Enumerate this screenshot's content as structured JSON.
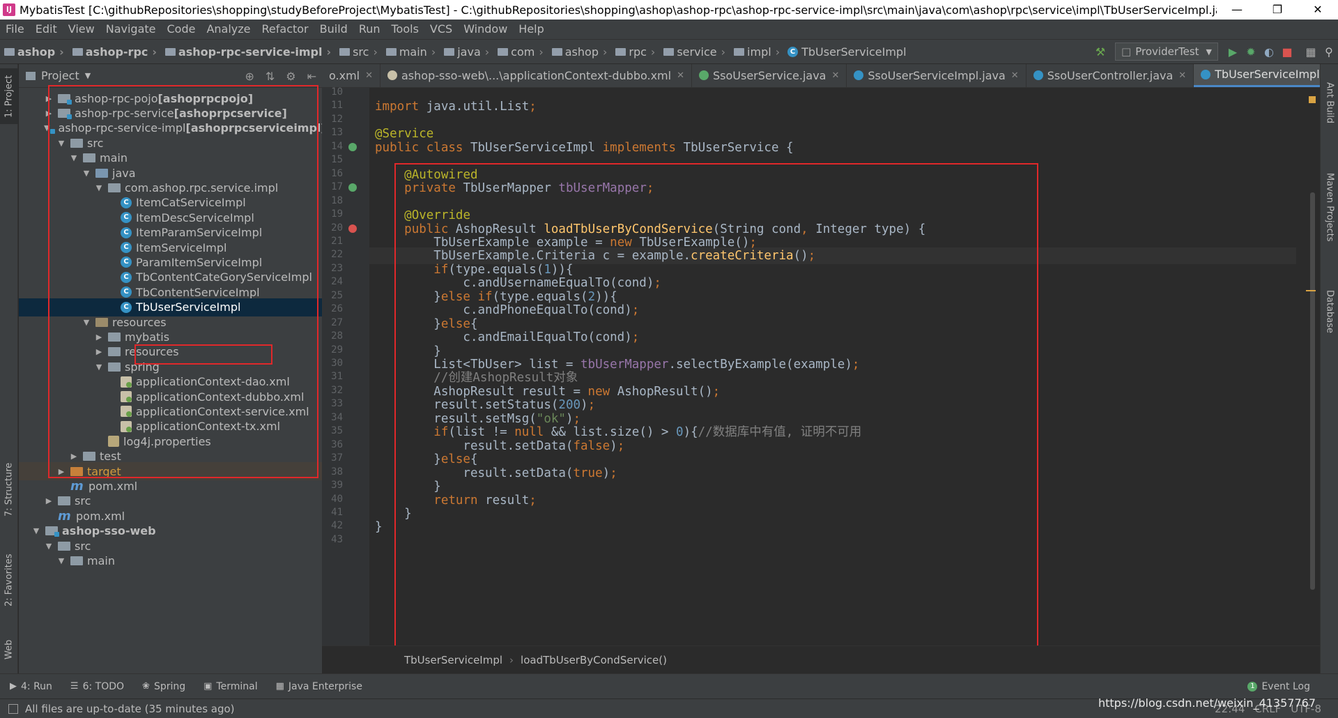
{
  "window": {
    "title": "MybatisTest [C:\\githubRepositories\\shopping\\studyBeforeProject\\MybatisTest] - C:\\githubRepositories\\shopping\\ashop\\ashop-rpc\\ashop-rpc-service-impl\\src\\main\\java\\com\\ashop\\rpc\\service\\impl\\TbUserServiceImpl.java [ashoprpc..."
  },
  "menu": [
    "File",
    "Edit",
    "View",
    "Navigate",
    "Code",
    "Analyze",
    "Refactor",
    "Build",
    "Run",
    "Tools",
    "VCS",
    "Window",
    "Help"
  ],
  "nav": {
    "crumbs": [
      "ashop",
      "ashop-rpc",
      "ashop-rpc-service-impl",
      "src",
      "main",
      "java",
      "com",
      "ashop",
      "rpc",
      "service",
      "impl"
    ],
    "file": "TbUserServiceImpl",
    "run_config": "ProviderTest"
  },
  "left_tabs": {
    "project": "1: Project",
    "structure": "7: Structure",
    "favorites": "2: Favorites",
    "web": "Web"
  },
  "right_tabs": {
    "ant": "Ant Build",
    "maven": "Maven Projects",
    "database": "Database"
  },
  "project": {
    "header": "Project",
    "tree": [
      {
        "indent": 1,
        "arrow": "right",
        "icon": "mod",
        "label": "ashop-rpc-pojo",
        "suffix": " [ashoprpcpojo]"
      },
      {
        "indent": 1,
        "arrow": "right",
        "icon": "mod",
        "label": "ashop-rpc-service",
        "suffix": " [ashoprpcservice]"
      },
      {
        "indent": 1,
        "arrow": "down",
        "icon": "mod",
        "label": "ashop-rpc-service-impl",
        "suffix": " [ashoprpcserviceimpl]"
      },
      {
        "indent": 2,
        "arrow": "down",
        "icon": "folder",
        "label": "src",
        "suffix": ""
      },
      {
        "indent": 3,
        "arrow": "down",
        "icon": "folder",
        "label": "main",
        "suffix": ""
      },
      {
        "indent": 4,
        "arrow": "down",
        "icon": "src",
        "label": "java",
        "suffix": ""
      },
      {
        "indent": 5,
        "arrow": "down",
        "icon": "pkg",
        "label": "com.ashop.rpc.service.impl",
        "suffix": ""
      },
      {
        "indent": 6,
        "arrow": "",
        "icon": "class",
        "label": "ItemCatServiceImpl",
        "suffix": ""
      },
      {
        "indent": 6,
        "arrow": "",
        "icon": "class",
        "label": "ItemDescServiceImpl",
        "suffix": ""
      },
      {
        "indent": 6,
        "arrow": "",
        "icon": "class",
        "label": "ItemParamServiceImpl",
        "suffix": ""
      },
      {
        "indent": 6,
        "arrow": "",
        "icon": "class",
        "label": "ItemServiceImpl",
        "suffix": ""
      },
      {
        "indent": 6,
        "arrow": "",
        "icon": "class",
        "label": "ParamItemServiceImpl",
        "suffix": ""
      },
      {
        "indent": 6,
        "arrow": "",
        "icon": "class",
        "label": "TbContentCateGoryServiceImpl",
        "suffix": ""
      },
      {
        "indent": 6,
        "arrow": "",
        "icon": "class",
        "label": "TbContentServiceImpl",
        "suffix": ""
      },
      {
        "indent": 6,
        "arrow": "",
        "icon": "class",
        "label": "TbUserServiceImpl",
        "suffix": "",
        "selected": true
      },
      {
        "indent": 4,
        "arrow": "down",
        "icon": "res",
        "label": "resources",
        "suffix": ""
      },
      {
        "indent": 5,
        "arrow": "right",
        "icon": "folder",
        "label": "mybatis",
        "suffix": ""
      },
      {
        "indent": 5,
        "arrow": "right",
        "icon": "folder",
        "label": "resources",
        "suffix": ""
      },
      {
        "indent": 5,
        "arrow": "down",
        "icon": "folder",
        "label": "spring",
        "suffix": ""
      },
      {
        "indent": 6,
        "arrow": "",
        "icon": "xml",
        "label": "applicationContext-dao.xml",
        "suffix": ""
      },
      {
        "indent": 6,
        "arrow": "",
        "icon": "xml",
        "label": "applicationContext-dubbo.xml",
        "suffix": ""
      },
      {
        "indent": 6,
        "arrow": "",
        "icon": "xml",
        "label": "applicationContext-service.xml",
        "suffix": ""
      },
      {
        "indent": 6,
        "arrow": "",
        "icon": "xml",
        "label": "applicationContext-tx.xml",
        "suffix": ""
      },
      {
        "indent": 5,
        "arrow": "",
        "icon": "prop",
        "label": "log4j.properties",
        "suffix": ""
      },
      {
        "indent": 3,
        "arrow": "right",
        "icon": "folder",
        "label": "test",
        "suffix": ""
      },
      {
        "indent": 2,
        "arrow": "right",
        "icon": "orange",
        "label": "target",
        "suffix": "",
        "excluded": true
      },
      {
        "indent": 2,
        "arrow": "",
        "icon": "maven",
        "label": "pom.xml",
        "suffix": ""
      },
      {
        "indent": 1,
        "arrow": "right",
        "icon": "folder",
        "label": "src",
        "suffix": ""
      },
      {
        "indent": 1,
        "arrow": "",
        "icon": "maven",
        "label": "pom.xml",
        "suffix": ""
      },
      {
        "indent": 0,
        "arrow": "down",
        "icon": "mod",
        "label": "ashop-sso-web",
        "suffix": "",
        "bold": true
      },
      {
        "indent": 1,
        "arrow": "down",
        "icon": "folder",
        "label": "src",
        "suffix": ""
      },
      {
        "indent": 2,
        "arrow": "down",
        "icon": "folder",
        "label": "main",
        "suffix": ""
      }
    ]
  },
  "tabs": [
    {
      "label": "o.xml",
      "icon": "",
      "active": false
    },
    {
      "label": "ashop-sso-web\\...\\applicationContext-dubbo.xml",
      "icon": "xml",
      "active": false
    },
    {
      "label": "SsoUserService.java",
      "icon": "iface",
      "active": false
    },
    {
      "label": "SsoUserServiceImpl.java",
      "icon": "class",
      "active": false
    },
    {
      "label": "SsoUserController.java",
      "icon": "class",
      "active": false
    },
    {
      "label": "TbUserServiceImpl.java",
      "icon": "class",
      "active": true
    }
  ],
  "code": {
    "first_line": 10,
    "lines": [
      [],
      [
        [
          "kw",
          "import "
        ],
        [
          "",
          "java.util.List"
        ],
        [
          "kw",
          ";"
        ]
      ],
      [],
      [
        [
          "an",
          "@Service"
        ]
      ],
      [
        [
          "kw",
          "public class "
        ],
        [
          "",
          "TbUserServiceImpl "
        ],
        [
          "kw",
          "implements "
        ],
        [
          "",
          "TbUserService {"
        ]
      ],
      [],
      [
        [
          "",
          "    "
        ],
        [
          "an",
          "@Autowired"
        ]
      ],
      [
        [
          "",
          "    "
        ],
        [
          "kw",
          "private "
        ],
        [
          "",
          "TbUserMapper "
        ],
        [
          "fld",
          "tbUserMapper"
        ],
        [
          "kw",
          ";"
        ]
      ],
      [],
      [
        [
          "",
          "    "
        ],
        [
          "an",
          "@Override"
        ]
      ],
      [
        [
          "",
          "    "
        ],
        [
          "kw",
          "public "
        ],
        [
          "",
          "AshopResult "
        ],
        [
          "mth",
          "loadTbUserByCondService"
        ],
        [
          "",
          "(String cond"
        ],
        [
          "kw",
          ", "
        ],
        [
          "",
          "Integer type) {"
        ]
      ],
      [
        [
          "",
          "        TbUserExample example = "
        ],
        [
          "kw",
          "new "
        ],
        [
          "",
          "TbUserExample()"
        ],
        [
          "kw",
          ";"
        ]
      ],
      [
        [
          "",
          "        TbUserExample.Criteria c = example."
        ],
        [
          "mth",
          "createCriteria"
        ],
        [
          "",
          "()"
        ],
        [
          "kw",
          ";"
        ]
      ],
      [
        [
          "",
          "        "
        ],
        [
          "kw",
          "if"
        ],
        [
          "",
          "(type.equals("
        ],
        [
          "num",
          "1"
        ],
        [
          "",
          "))"
        ],
        [
          "",
          "{"
        ]
      ],
      [
        [
          "",
          "            c.andUsernameEqualTo(cond)"
        ],
        [
          "kw",
          ";"
        ]
      ],
      [
        [
          "",
          "        }"
        ],
        [
          "kw",
          "else if"
        ],
        [
          "",
          "(type.equals("
        ],
        [
          "num",
          "2"
        ],
        [
          "",
          "))"
        ],
        [
          "",
          "{"
        ]
      ],
      [
        [
          "",
          "            c.andPhoneEqualTo(cond)"
        ],
        [
          "kw",
          ";"
        ]
      ],
      [
        [
          "",
          "        }"
        ],
        [
          "kw",
          "else"
        ],
        [
          "",
          "{"
        ]
      ],
      [
        [
          "",
          "            c.andEmailEqualTo(cond)"
        ],
        [
          "kw",
          ";"
        ]
      ],
      [
        [
          "",
          "        }"
        ]
      ],
      [
        [
          "",
          "        List<TbUser> list = "
        ],
        [
          "fld",
          "tbUserMapper"
        ],
        [
          "",
          ".selectByExample(example)"
        ],
        [
          "kw",
          ";"
        ]
      ],
      [
        [
          "",
          "        "
        ],
        [
          "cmt",
          "//创建AshopResult对象"
        ]
      ],
      [
        [
          "",
          "        AshopResult result = "
        ],
        [
          "kw",
          "new "
        ],
        [
          "",
          "AshopResult()"
        ],
        [
          "kw",
          ";"
        ]
      ],
      [
        [
          "",
          "        result.setStatus("
        ],
        [
          "num",
          "200"
        ],
        [
          "",
          ")"
        ],
        [
          "kw",
          ";"
        ]
      ],
      [
        [
          "",
          "        result.setMsg("
        ],
        [
          "str",
          "\"ok\""
        ],
        [
          "",
          ")"
        ],
        [
          "kw",
          ";"
        ]
      ],
      [
        [
          "",
          "        "
        ],
        [
          "kw",
          "if"
        ],
        [
          "",
          "(list != "
        ],
        [
          "kw",
          "null "
        ],
        [
          "",
          "&& list.size() > "
        ],
        [
          "num",
          "0"
        ],
        [
          "",
          ")"
        ],
        [
          "",
          "{"
        ],
        [
          "cmt",
          "//数据库中有值, 证明不可用"
        ]
      ],
      [
        [
          "",
          "            result.setData("
        ],
        [
          "kw",
          "false"
        ],
        [
          "",
          ")"
        ],
        [
          "kw",
          ";"
        ]
      ],
      [
        [
          "",
          "        }"
        ],
        [
          "kw",
          "else"
        ],
        [
          "",
          "{"
        ]
      ],
      [
        [
          "",
          "            result.setData("
        ],
        [
          "kw",
          "true"
        ],
        [
          "",
          ")"
        ],
        [
          "kw",
          ";"
        ]
      ],
      [
        [
          "",
          "        }"
        ]
      ],
      [
        [
          "",
          "        "
        ],
        [
          "kw",
          "return "
        ],
        [
          "",
          "result"
        ],
        [
          "kw",
          ";"
        ]
      ],
      [
        [
          "",
          "    }"
        ]
      ],
      [
        [
          "",
          "}"
        ]
      ],
      []
    ]
  },
  "editor_breadcrumb": [
    "TbUserServiceImpl",
    "loadTbUserByCondService()"
  ],
  "bottom_tabs": [
    {
      "icon": "▶",
      "label": "4: Run"
    },
    {
      "icon": "☰",
      "label": "6: TODO"
    },
    {
      "icon": "❀",
      "label": "Spring"
    },
    {
      "icon": "▣",
      "label": "Terminal"
    },
    {
      "icon": "▦",
      "label": "Java Enterprise"
    }
  ],
  "event_log": "Event Log",
  "status": {
    "message": "All files are up-to-date (35 minutes ago)",
    "position": "22:44",
    "line_sep": "CRLF",
    "encoding": "UTF-8",
    "watermark": "https://blog.csdn.net/weixin_41357767"
  },
  "colors": {
    "accent": "#4a88c7",
    "highlight_box": "#e0282a",
    "selection": "#0d293e"
  }
}
